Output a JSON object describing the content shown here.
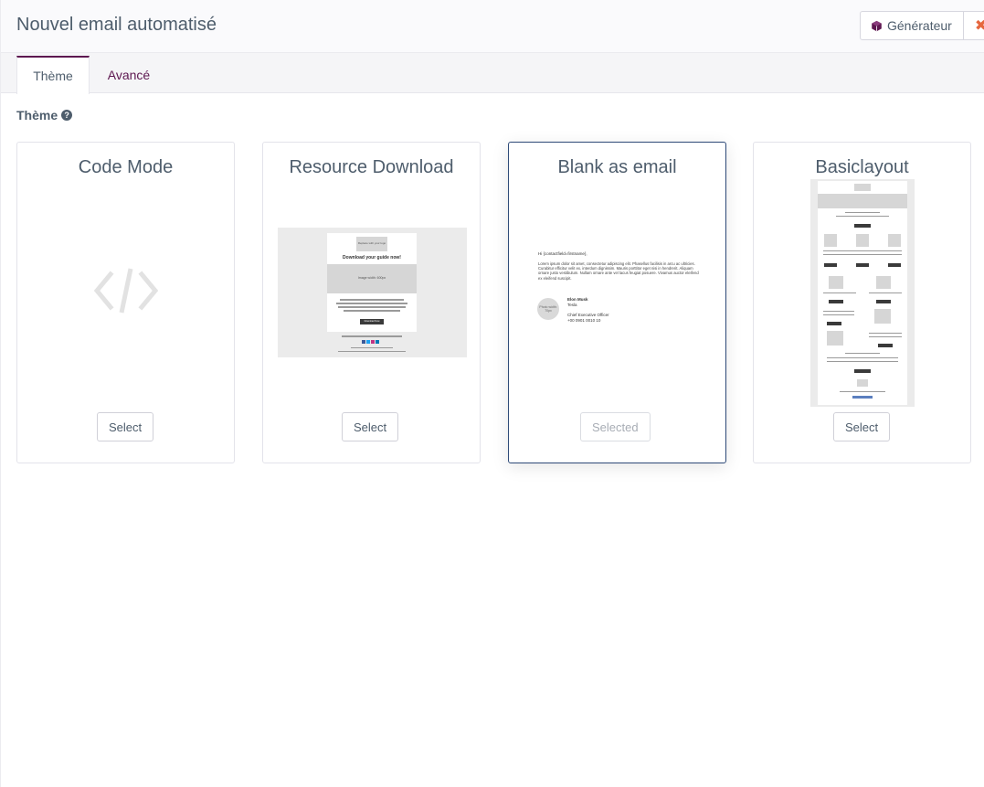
{
  "header": {
    "title": "Nouvel email automatisé",
    "builder_label": "Générateur",
    "close_glyph": "✖"
  },
  "tabs": [
    {
      "label": "Thème",
      "active": true
    },
    {
      "label": "Avancé",
      "active": false
    }
  ],
  "theme_section": {
    "label": "Thème",
    "help_glyph": "?"
  },
  "themes": [
    {
      "title": "Code Mode",
      "button": "Select",
      "selected": false,
      "icon": "code-icon"
    },
    {
      "title": "Resource Download",
      "button": "Select",
      "selected": false
    },
    {
      "title": "Blank as email",
      "button": "Selected",
      "selected": true
    },
    {
      "title": "Basiclayout",
      "button": "Select",
      "selected": false
    }
  ],
  "previews": {
    "resource": {
      "logo": "Replace with your logo",
      "heading": "Download your guide now!",
      "banner": "Image width: 600px",
      "cta": "Download Now"
    },
    "blank": {
      "greeting": "Hi {contactfield=firstname},",
      "body": "Lorem ipsum dolor sit amet, consectetur adipiscing elit. Phasellus facilisis in arcu ac ultricies. Curabitur efficitur velit ex, interdum dignissim. Mauris porttitor eget nisi in hendrerit. Aliquam ornare justo vestibulum. Nullam ornare ante vel lacus feugiat posuere. Vivamus auctor eleifend ex eleifend suscipit.",
      "avatar": "Photo width: 70px",
      "name": "Elon Musk",
      "company": "Tesla",
      "role": "Chief Executive Officer",
      "phone": "+00 0901 0010 10"
    }
  },
  "colors": {
    "accent": "#5d1750",
    "text": "#4e5d6c",
    "selected_border": "#2e4a78",
    "close": "#e6673f"
  }
}
